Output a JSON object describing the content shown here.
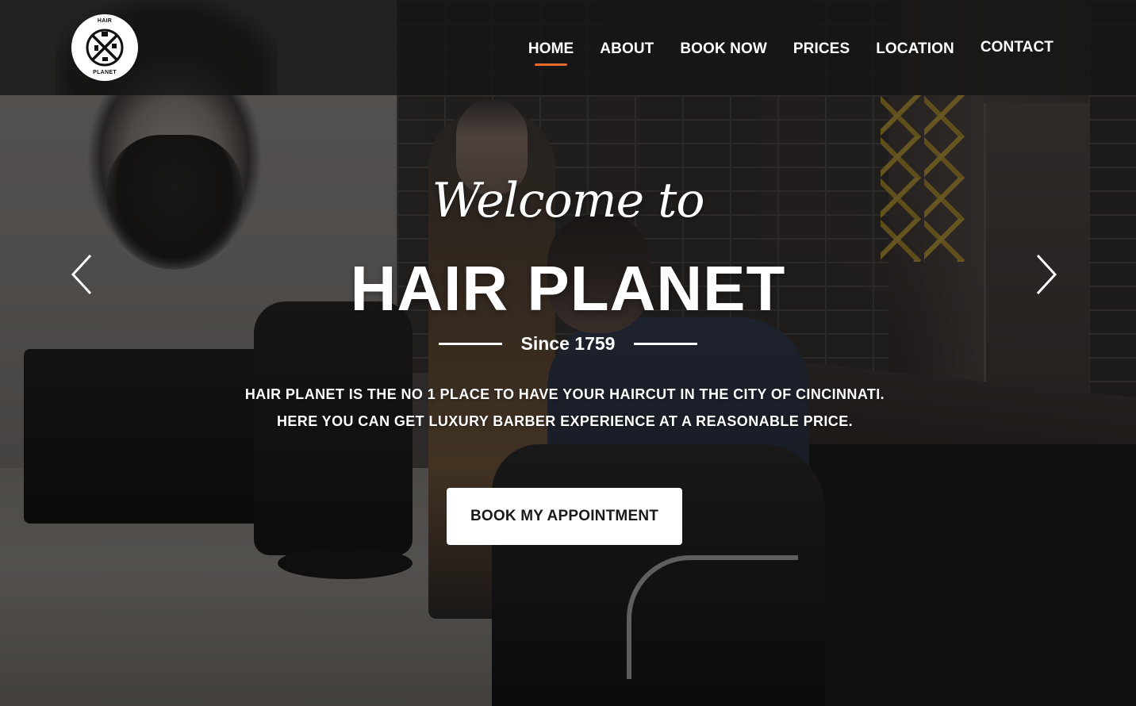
{
  "header": {
    "logo": {
      "top_text": "HAIR",
      "bottom_text": "PLANET"
    },
    "nav": [
      {
        "label": "HOME",
        "active": true
      },
      {
        "label": "ABOUT",
        "active": false
      },
      {
        "label": "BOOK NOW",
        "active": false
      },
      {
        "label": "PRICES",
        "active": false
      },
      {
        "label": "LOCATION",
        "active": false
      },
      {
        "label": "CONTACT",
        "active": false
      }
    ],
    "accent_color": "#e86c2b"
  },
  "hero": {
    "welcome": "Welcome to",
    "title": "HAIR PLANET",
    "since": "Since 1759",
    "description": "HAIR PLANET IS THE NO 1 PLACE TO HAVE YOUR HAIRCUT IN THE CITY OF CINCINNATI. HERE YOU CAN GET LUXURY BARBER EXPERIENCE AT A REASONABLE PRICE.",
    "cta_label": "BOOK MY APPOINTMENT"
  },
  "carousel": {
    "prev_icon": "chevron-left-icon",
    "next_icon": "chevron-right-icon"
  }
}
